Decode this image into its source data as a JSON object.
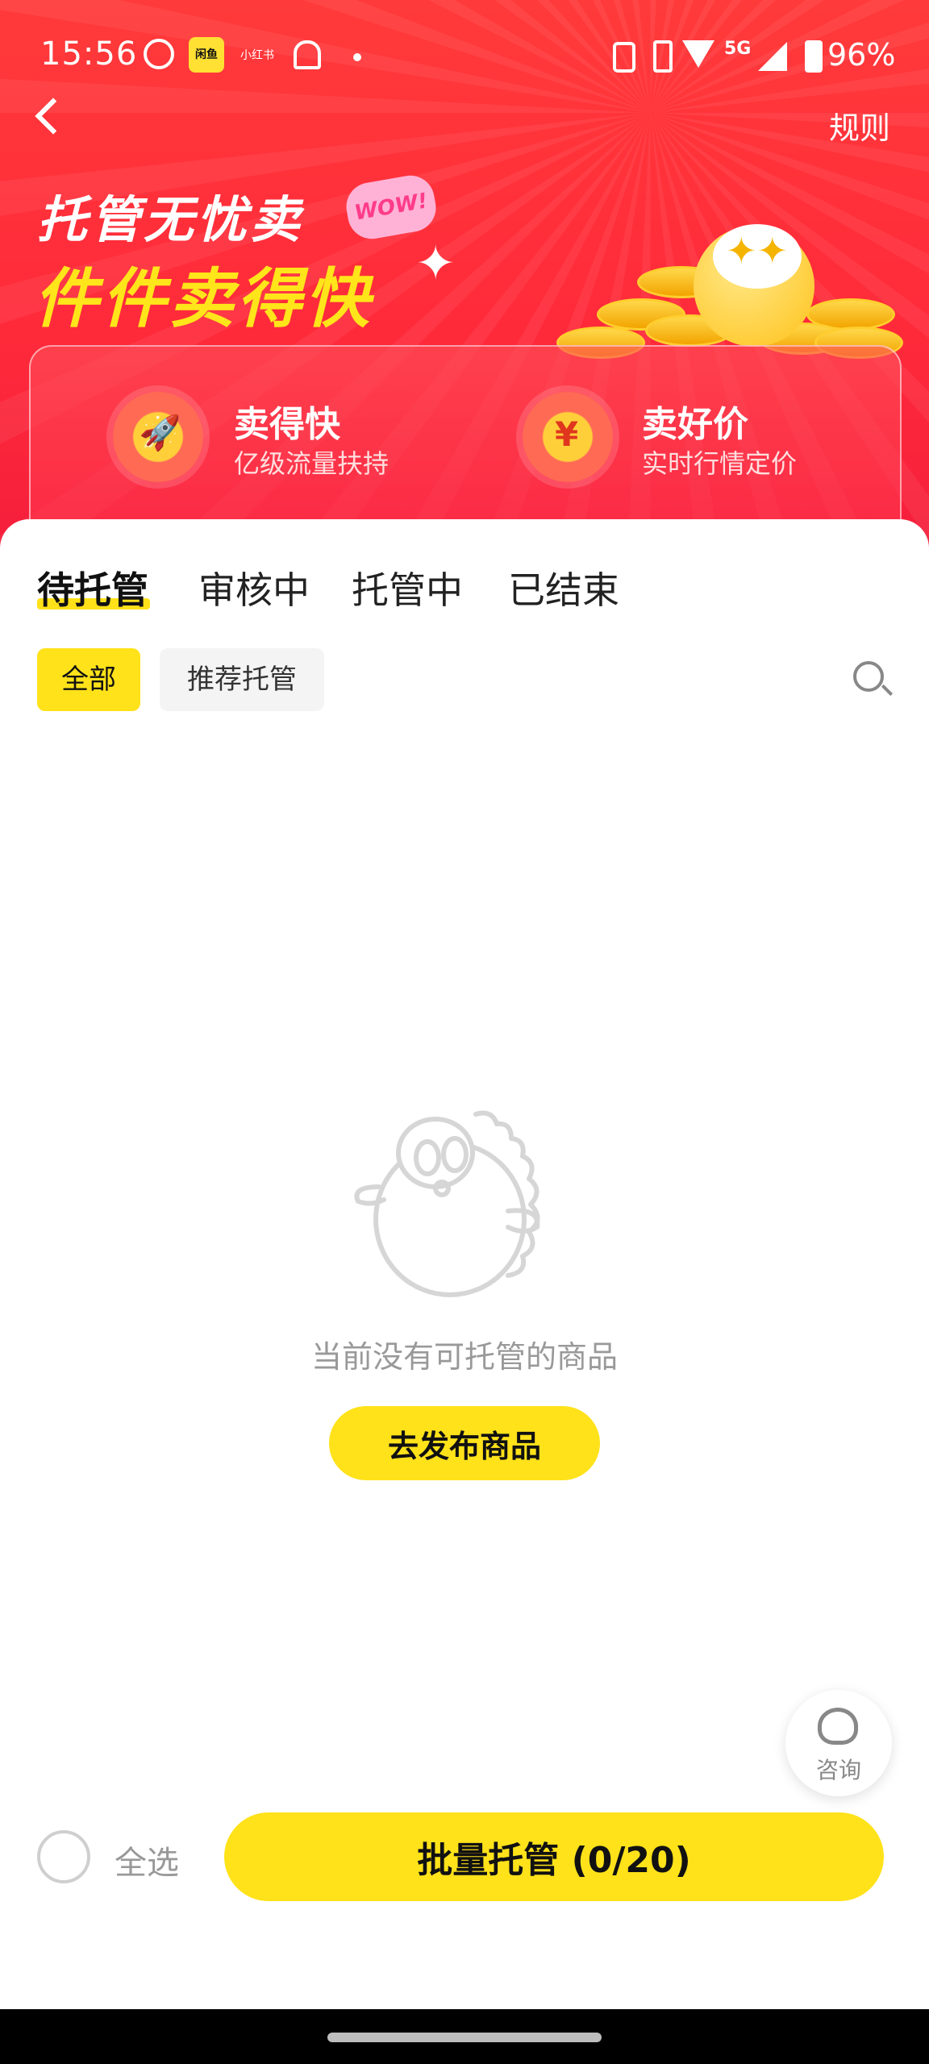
{
  "status_bar": {
    "time": "15:56",
    "network": "5G",
    "battery": "96%",
    "app_icon_xianyu": "闲鱼",
    "app_icon_redbook": "小红书"
  },
  "header": {
    "rules_label": "规则",
    "title_line1": "托管无忧卖",
    "title_line2": "件件卖得快",
    "badge": "WOW!"
  },
  "features": [
    {
      "icon": "rocket-icon",
      "glyph": "🚀",
      "title": "卖得快",
      "subtitle": "亿级流量扶持"
    },
    {
      "icon": "yen-icon",
      "glyph": "¥",
      "title": "卖好价",
      "subtitle": "实时行情定价"
    }
  ],
  "tabs": [
    {
      "label": "待托管",
      "active": true
    },
    {
      "label": "审核中",
      "active": false
    },
    {
      "label": "托管中",
      "active": false
    },
    {
      "label": "已结束",
      "active": false
    }
  ],
  "filters": [
    {
      "label": "全部",
      "active": true
    },
    {
      "label": "推荐托管",
      "active": false
    }
  ],
  "empty_state": {
    "message": "当前没有可托管的商品",
    "button": "去发布商品"
  },
  "consult": {
    "label": "咨询"
  },
  "bottom_bar": {
    "select_all_label": "全选",
    "batch_button": "批量托管",
    "batch_count": "(0/20)"
  },
  "colors": {
    "accent_yellow": "#ffe21a",
    "banner_red": "#ff2b3a"
  }
}
